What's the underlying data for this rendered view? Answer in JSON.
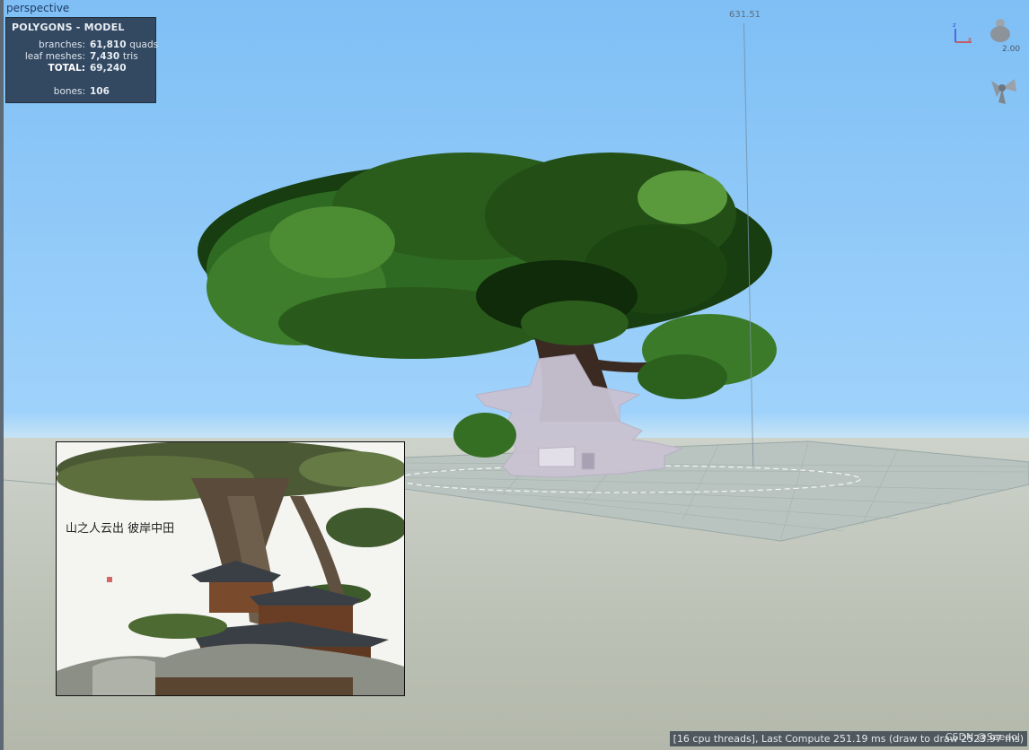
{
  "viewport": {
    "view_name": "perspective",
    "height_measure": "631.51",
    "zoom_level": "2.00"
  },
  "stats_panel": {
    "title": "POLYGONS - MODEL",
    "rows": [
      {
        "label": "branches:",
        "value": "61,810",
        "unit": "quads"
      },
      {
        "label": "leaf meshes:",
        "value": "7,430",
        "unit": "tris"
      },
      {
        "label": "TOTAL:",
        "value": "69,240",
        "unit": ""
      },
      {
        "label": "bones:",
        "value": "106",
        "unit": ""
      }
    ]
  },
  "axis_gizmo": {
    "z_label": "z",
    "x_label": "x"
  },
  "reference_image": {
    "calligraphy": "山之人云出 彼岸中田"
  },
  "status_bar": {
    "text": "[16 cpu threads], Last Compute 251.19 ms (draw to draw 2523.97 ms)"
  },
  "watermark": "CSDN @Saedol",
  "colors": {
    "sky_top": "#7fbff5",
    "ground": "#bcc1b5",
    "stats_bg": "#2c3e54",
    "foliage": "#3f7a2a",
    "building_ghost": "#c9c2d2"
  }
}
